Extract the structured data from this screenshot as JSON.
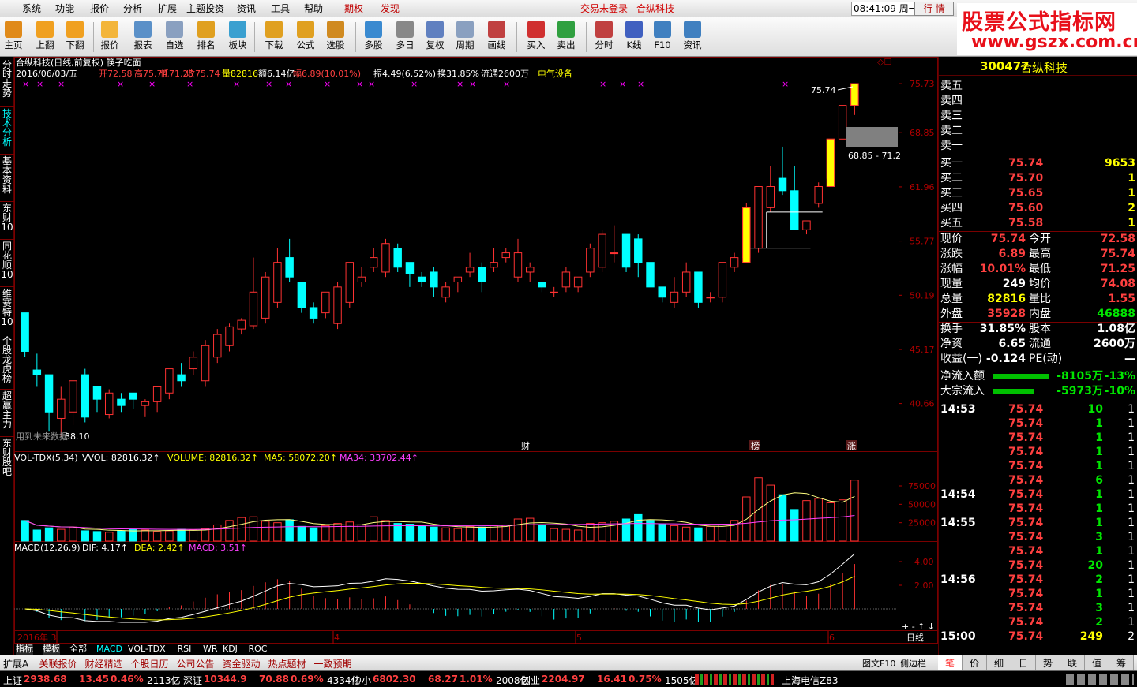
{
  "menubar": {
    "items": [
      "系统",
      "功能",
      "报价",
      "分析",
      "扩展",
      "主题投资",
      "资讯",
      "工具",
      "帮助"
    ],
    "special": [
      "期权",
      "发现"
    ],
    "login": "交易未登录",
    "stock": "合纵科技",
    "clock": "08:41:09 周一",
    "hangqing": "行 情"
  },
  "watermark": {
    "line1": "股票公式指标网",
    "line2": "www.gszx.com.cn"
  },
  "toolbar": [
    {
      "label": "主页",
      "icon": "home-icon",
      "color": "#e08a1a"
    },
    {
      "label": "上翻",
      "icon": "arrow-up-icon",
      "color": "#f0a020"
    },
    {
      "label": "下翻",
      "icon": "arrow-down-icon",
      "color": "#f0a020"
    },
    {
      "label": "报价",
      "icon": "yen-icon",
      "color": "#f3b53a"
    },
    {
      "label": "报表",
      "icon": "report-icon",
      "color": "#5a90c8"
    },
    {
      "label": "自选",
      "icon": "f6-icon",
      "color": "#8aa0c0"
    },
    {
      "label": "排名",
      "icon": "ranking-icon",
      "color": "#e0a020"
    },
    {
      "label": "板块",
      "icon": "blocks-icon",
      "color": "#3aa0d0"
    },
    {
      "label": "下载",
      "icon": "download-icon",
      "color": "#e0a020"
    },
    {
      "label": "公式",
      "icon": "formula-icon",
      "color": "#e0a020"
    },
    {
      "label": "选股",
      "icon": "select-stock-icon",
      "color": "#d08a20"
    },
    {
      "label": "多股",
      "icon": "multi-stock-icon",
      "color": "#3a8ad0"
    },
    {
      "label": "多日",
      "icon": "multi-day-icon",
      "color": "#888888"
    },
    {
      "label": "复权",
      "icon": "restore-rights-icon",
      "color": "#6080c0"
    },
    {
      "label": "周期",
      "icon": "f8-icon",
      "color": "#8aa0c0"
    },
    {
      "label": "画线",
      "icon": "draw-line-icon",
      "color": "#c04040"
    },
    {
      "label": "买入",
      "icon": "buy-icon",
      "color": "#d03030"
    },
    {
      "label": "卖出",
      "icon": "sell-icon",
      "color": "#30a040"
    },
    {
      "label": "分时",
      "icon": "intraday-icon",
      "color": "#c04040"
    },
    {
      "label": "K线",
      "icon": "kline-icon",
      "color": "#4060c0"
    },
    {
      "label": "F10",
      "icon": "f10-icon",
      "color": "#4080c0"
    },
    {
      "label": "资讯",
      "icon": "news-icon",
      "color": "#4080c0"
    }
  ],
  "leftnav": [
    {
      "label": "分时走势",
      "active": false
    },
    {
      "label": "技术分析",
      "active": true
    },
    {
      "label": "基本资料",
      "active": false
    },
    {
      "label": "东财10",
      "active": false
    },
    {
      "label": "同花顺10",
      "active": false
    },
    {
      "label": "维赛特10",
      "active": false
    },
    {
      "label": "个股龙虎榜",
      "active": false
    },
    {
      "label": "超赢主力",
      "active": false
    },
    {
      "label": "东财股吧",
      "active": false
    }
  ],
  "chart": {
    "title": "合纵科技(日线,前复权) 筷子吃面",
    "info_date": "2016/06/03/五",
    "info_open": "开72.58",
    "info_high": "高75.74",
    "info_low": "低71.25",
    "info_close": "收75.74",
    "info_vol": "量82816",
    "info_amt": "额6.14亿",
    "info_pct": "幅6.89(10.01%)",
    "info_amp": "振4.49(6.52%)",
    "info_turn": "换31.85%",
    "info_float": "流通2600万",
    "info_sector": "电气设备",
    "price_axis": [
      "75.73",
      "68.85",
      "61.96",
      "55.77",
      "50.19",
      "45.17",
      "40.66"
    ],
    "vol_axis": [
      "75000",
      "50000",
      "25000"
    ],
    "macd_axis": [
      "4.00",
      "2.00"
    ],
    "high_label": "75.74",
    "low_label": "38.10",
    "range_label": "68.85 - 71.2",
    "note_label": "用到未来数据",
    "vol_title": "VOL-TDX(5,34)",
    "vvol": "VVOL: 82816.32",
    "volume": "VOLUME: 82816.32",
    "ma5": "MA5: 58072.20",
    "ma34": "MA34: 33702.44",
    "macd_title": "MACD(12,26,9)",
    "dif": "DIF: 4.17",
    "dea": "DEA: 2.42",
    "macd": "MACD: 3.51",
    "date_labels": [
      "2016年 3",
      "4",
      "5",
      "6"
    ],
    "period": "日线",
    "markers": [
      "财",
      "榜",
      "涨"
    ],
    "colors": {
      "up": "#ff3232",
      "down": "#00ffff",
      "yellow": "#ffff00"
    }
  },
  "chart_data": {
    "type": "candlestick",
    "o": [
      48.5,
      43.4,
      43.0,
      39.5,
      40.0,
      43.0,
      42.0,
      39.8,
      41.0,
      41.5,
      40.5,
      40.8,
      41.5,
      43.0,
      43.5,
      42.5,
      44.5,
      45.5,
      47.0,
      47.3,
      48.0,
      49.5,
      54.0,
      51.5,
      49.0,
      48.5,
      47.5,
      49.5,
      51.5,
      53.0,
      52.5,
      55.0,
      53.5,
      52.0,
      52.5,
      50.0,
      51.5,
      52.5,
      53.0,
      53.0,
      54.0,
      52.0,
      52.5,
      51.5,
      50.5,
      51.0,
      51.0,
      52.5,
      53.0,
      54.5,
      56.5,
      56.0,
      53.5,
      51.0,
      49.5,
      50.5,
      52.5,
      50.0,
      50.0,
      53.0,
      54.0,
      55.0,
      59.5,
      63.0,
      61.5,
      57.0,
      60.0,
      63.0,
      68.0,
      72.6
    ],
    "c": [
      45.0,
      43.0,
      40.0,
      41.0,
      42.5,
      39.6,
      41.0,
      41.5,
      40.5,
      41.0,
      40.8,
      42.0,
      43.5,
      42.5,
      44.5,
      45.5,
      46.5,
      47.2,
      47.8,
      50.5,
      52.0,
      53.5,
      52.0,
      49.0,
      48.0,
      50.5,
      51.0,
      53.5,
      52.0,
      54.0,
      55.5,
      53.0,
      52.3,
      51.5,
      51.0,
      51.0,
      52.0,
      53.0,
      51.5,
      53.5,
      54.5,
      54.5,
      53.0,
      51.0,
      50.5,
      52.5,
      52.0,
      55.0,
      56.5,
      54.5,
      53.0,
      53.5,
      51.0,
      50.0,
      50.5,
      52.5,
      49.5,
      50.0,
      53.5,
      54.0,
      59.5,
      62.0,
      62.0,
      61.5,
      57.0,
      58.0,
      62.0,
      68.0,
      72.6,
      75.74
    ],
    "h": [
      48.5,
      44.8,
      43.0,
      42.0,
      42.5,
      43.5,
      42.0,
      41.8,
      41.5,
      41.5,
      41.0,
      42.0,
      43.5,
      44.0,
      45.0,
      46.0,
      47.0,
      47.5,
      48.0,
      54.0,
      52.5,
      55.0,
      56.0,
      51.5,
      49.5,
      50.5,
      51.5,
      53.5,
      53.0,
      55.0,
      56.0,
      55.5,
      53.5,
      52.5,
      53.0,
      51.5,
      52.0,
      54.5,
      53.5,
      55.0,
      55.0,
      56.0,
      53.5,
      51.5,
      51.0,
      53.0,
      52.0,
      55.5,
      57.0,
      57.5,
      56.5,
      56.5,
      53.5,
      51.0,
      52.0,
      53.5,
      52.5,
      50.5,
      53.5,
      54.5,
      60.0,
      62.0,
      64.5,
      67.0,
      64.5,
      58.0,
      62.5,
      65.5,
      72.6,
      75.74
    ],
    "l": [
      44.5,
      42.0,
      38.5,
      38.1,
      39.0,
      39.2,
      40.0,
      39.5,
      40.0,
      40.2,
      39.6,
      40.0,
      41.0,
      42.0,
      43.0,
      42.0,
      44.0,
      45.0,
      46.5,
      47.0,
      47.5,
      49.0,
      51.5,
      48.5,
      47.5,
      48.0,
      47.0,
      49.0,
      51.0,
      52.5,
      52.0,
      52.5,
      51.0,
      51.0,
      50.0,
      49.5,
      50.5,
      52.0,
      50.5,
      52.5,
      53.5,
      51.5,
      51.5,
      50.5,
      50.0,
      50.5,
      50.5,
      52.0,
      52.5,
      53.5,
      52.5,
      52.0,
      51.0,
      49.5,
      49.0,
      50.0,
      49.0,
      49.5,
      49.5,
      52.5,
      53.5,
      54.5,
      59.0,
      61.0,
      57.0,
      56.5,
      59.5,
      62.5,
      68.0,
      71.25
    ],
    "volume": [
      28000,
      15000,
      18000,
      16000,
      19000,
      14000,
      13000,
      12000,
      14000,
      16000,
      15000,
      13000,
      14000,
      16000,
      15000,
      17000,
      22000,
      28000,
      32000,
      33000,
      27000,
      25000,
      29000,
      20000,
      18000,
      21000,
      24000,
      26000,
      22000,
      33000,
      28000,
      24000,
      23000,
      21000,
      19000,
      18000,
      17000,
      20000,
      19000,
      21000,
      22000,
      30000,
      31000,
      22000,
      17000,
      16000,
      15000,
      24000,
      25000,
      27000,
      30000,
      36000,
      28000,
      23000,
      21000,
      19000,
      18000,
      20000,
      22000,
      28000,
      60000,
      86000,
      76000,
      63000,
      43000,
      55000,
      58000,
      52000,
      56000,
      82816
    ],
    "vol_ma5_end": 58072.2,
    "vol_ma34_end": 33702.44,
    "dif_end": 4.17,
    "dea_end": 2.42,
    "macd_end": 3.51,
    "ylim_price": [
      38.1,
      75.74
    ]
  },
  "quote": {
    "code": "300477",
    "name": "合纵科技",
    "sell_labels": [
      "卖五",
      "卖四",
      "卖三",
      "卖二",
      "卖一"
    ],
    "buy": [
      {
        "label": "买一",
        "price": "75.74",
        "vol": "9653"
      },
      {
        "label": "买二",
        "price": "75.70",
        "vol": "1"
      },
      {
        "label": "买三",
        "price": "75.65",
        "vol": "1"
      },
      {
        "label": "买四",
        "price": "75.60",
        "vol": "2"
      },
      {
        "label": "买五",
        "price": "75.58",
        "vol": "1"
      }
    ],
    "stats": [
      {
        "k1": "现价",
        "v1": "75.74",
        "k2": "今开",
        "v2": "72.58",
        "c1": "red",
        "c2": "red"
      },
      {
        "k1": "涨跌",
        "v1": "6.89",
        "k2": "最高",
        "v2": "75.74",
        "c1": "red",
        "c2": "red"
      },
      {
        "k1": "涨幅",
        "v1": "10.01%",
        "k2": "最低",
        "v2": "71.25",
        "c1": "red",
        "c2": "red"
      },
      {
        "k1": "现量",
        "v1": "249",
        "k2": "均价",
        "v2": "74.08",
        "c1": "hl",
        "c2": "red"
      },
      {
        "k1": "总量",
        "v1": "82816",
        "k2": "量比",
        "v2": "1.55",
        "c1": "yel",
        "c2": "red"
      },
      {
        "k1": "外盘",
        "v1": "35928",
        "k2": "内盘",
        "v2": "46888",
        "c1": "red",
        "c2": "grn"
      },
      {
        "k1": "换手",
        "v1": "31.85%",
        "k2": "股本",
        "v2": "1.08亿",
        "c1": "hl",
        "c2": "hl"
      },
      {
        "k1": "净资",
        "v1": "6.65",
        "k2": "流通",
        "v2": "2600万",
        "c1": "hl",
        "c2": "hl"
      },
      {
        "k1": "收益(一)",
        "v1": "-0.124",
        "k2": "PE(动)",
        "v2": "—",
        "c1": "hl",
        "c2": "hl"
      }
    ],
    "flow": [
      {
        "label": "净流入额",
        "value": "-8105万",
        "pct": "-13%"
      },
      {
        "label": "大宗流入",
        "value": "-5973万",
        "pct": "-10%"
      }
    ],
    "ticks": [
      {
        "t": "14:53",
        "p": "75.74",
        "v": "10",
        "n": "1"
      },
      {
        "t": "",
        "p": "75.74",
        "v": "1",
        "n": "1"
      },
      {
        "t": "",
        "p": "75.74",
        "v": "1",
        "n": "1"
      },
      {
        "t": "",
        "p": "75.74",
        "v": "1",
        "n": "1"
      },
      {
        "t": "",
        "p": "75.74",
        "v": "1",
        "n": "1"
      },
      {
        "t": "",
        "p": "75.74",
        "v": "6",
        "n": "1"
      },
      {
        "t": "14:54",
        "p": "75.74",
        "v": "1",
        "n": "1"
      },
      {
        "t": "",
        "p": "75.74",
        "v": "1",
        "n": "1"
      },
      {
        "t": "14:55",
        "p": "75.74",
        "v": "1",
        "n": "1"
      },
      {
        "t": "",
        "p": "75.74",
        "v": "3",
        "n": "1"
      },
      {
        "t": "",
        "p": "75.74",
        "v": "1",
        "n": "1"
      },
      {
        "t": "",
        "p": "75.74",
        "v": "20",
        "n": "1"
      },
      {
        "t": "14:56",
        "p": "75.74",
        "v": "2",
        "n": "1"
      },
      {
        "t": "",
        "p": "75.74",
        "v": "1",
        "n": "1"
      },
      {
        "t": "",
        "p": "75.74",
        "v": "3",
        "n": "1"
      },
      {
        "t": "",
        "p": "75.74",
        "v": "2",
        "n": "1"
      },
      {
        "t": "15:00",
        "p": "75.74",
        "v": "249",
        "n": "2"
      }
    ],
    "tabs": [
      "笔",
      "价",
      "细",
      "日",
      "势",
      "联",
      "值",
      "筹"
    ]
  },
  "indicator_tabs": [
    "指标",
    "模板",
    "全部",
    "MACD",
    "VOL-TDX",
    "RSI",
    "WR",
    "KDJ",
    "ROC"
  ],
  "bottom_tabs": [
    "扩展A",
    "关联报价",
    "财经精选",
    "个股日历",
    "公司公告",
    "资金驱动",
    "热点题材",
    "一致预期"
  ],
  "bottom_right": [
    "图文F10",
    "侧边栏"
  ],
  "status": [
    {
      "name": "上证",
      "val": "2938.68",
      "chg": "13.45",
      "pct": "0.46%",
      "amt": "2113亿"
    },
    {
      "name": "深证",
      "val": "10344.9",
      "chg": "70.88",
      "pct": "0.69%",
      "amt": "4334亿"
    },
    {
      "name": "中小",
      "val": "6802.30",
      "chg": "68.27",
      "pct": "1.01%",
      "amt": "2008亿"
    },
    {
      "name": "创业",
      "val": "2204.97",
      "chg": "16.41",
      "pct": "0.75%",
      "amt": "1505亿"
    }
  ],
  "network": "上海电信Z83"
}
